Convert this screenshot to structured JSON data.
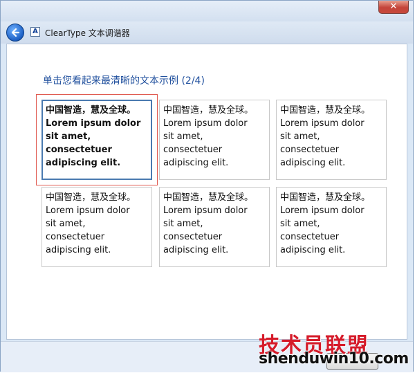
{
  "window": {
    "title": "ClearType 文本调谐器",
    "close_label": "✕"
  },
  "nav": {
    "app_icon_letter": "A"
  },
  "content": {
    "instruction": "单击您看起来最清晰的文本示例 (2/4)",
    "samples": [
      {
        "text": "中国智造，慧及全球。\nLorem ipsum dolor\nsit amet,\nconsectetuer\nadipiscing elit.",
        "selected": true
      },
      {
        "text": "中国智造，慧及全球。\nLorem ipsum dolor\nsit amet,\nconsectetuer\nadipiscing elit.",
        "selected": false
      },
      {
        "text": "中国智造，慧及全球。\nLorem ipsum dolor\nsit amet,\nconsectetuer\nadipiscing elit.",
        "selected": false
      },
      {
        "text": "中国智造，慧及全球。\nLorem ipsum dolor\nsit amet,\nconsectetuer\nadipiscing elit.",
        "selected": false
      },
      {
        "text": "中国智造，慧及全球。\nLorem ipsum dolor\nsit amet,\nconsectetuer\nadipiscing elit.",
        "selected": false
      },
      {
        "text": "中国智造，慧及全球。\nLorem ipsum dolor\nsit amet,\nconsectetuer\nadipiscing elit.",
        "selected": false
      }
    ]
  },
  "watermark": {
    "line1": "技术员联盟",
    "line2": "shenduwin10.com"
  },
  "colors": {
    "instruction_text": "#1f4f9d",
    "selection_border": "#4a7ab0",
    "focus_outline": "#e05a50",
    "close_button": "#c7493c"
  }
}
